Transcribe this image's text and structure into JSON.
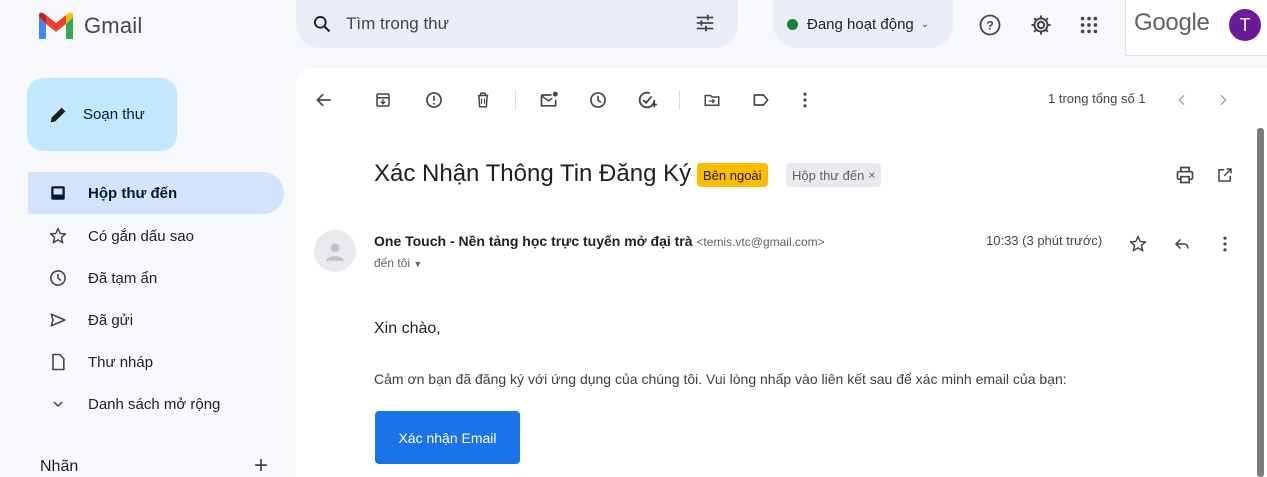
{
  "header": {
    "app_name": "Gmail",
    "search_placeholder": "Tìm trong thư",
    "status_label": "Đang hoạt động",
    "brand": "Google",
    "avatar_initial": "T"
  },
  "sidebar": {
    "compose_label": "Soạn thư",
    "items": [
      {
        "label": "Hộp thư đến",
        "icon": "inbox-icon",
        "active": true
      },
      {
        "label": "Có gắn dấu sao",
        "icon": "star-icon"
      },
      {
        "label": "Đã tạm ẩn",
        "icon": "clock-icon"
      },
      {
        "label": "Đã gửi",
        "icon": "send-icon"
      },
      {
        "label": "Thư nháp",
        "icon": "draft-icon"
      },
      {
        "label": "Danh sách mở rộng",
        "icon": "chevron-down-icon"
      }
    ],
    "labels_heading": "Nhãn",
    "labels_add": "+"
  },
  "toolbar": {
    "pager_text": "1 trong tổng số 1"
  },
  "message": {
    "subject": "Xác Nhận Thông Tin Đăng Ký",
    "badge_external": "Bên ngoài",
    "badge_inbox": "Hộp thư đến",
    "badge_inbox_close": "×",
    "sender_name": "One Touch - Nền tảng học trực tuyến mở đại trà",
    "sender_email": "<temis.vtc@gmail.com>",
    "recipient": "đến tôi",
    "time": "10:33 (3 phút trước)",
    "greeting": "Xin chào,",
    "body": "Cảm ơn bạn đã đăng ký với ứng dụng của chúng tôi. Vui lòng nhấp vào liên kết sau để xác minh email của bạn:",
    "button_label": "Xác nhận Email"
  },
  "colors": {
    "accent": "#1a73e8",
    "compose_bg": "#c2e7ff",
    "active_nav_bg": "#d3e3fd",
    "external_badge": "#fbbc04",
    "status_green": "#188038",
    "avatar_purple": "#6a1b9a"
  }
}
